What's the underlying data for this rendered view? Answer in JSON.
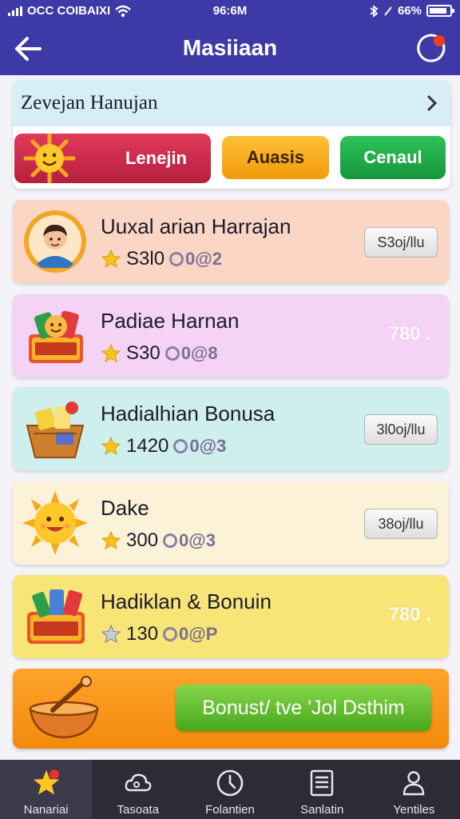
{
  "status": {
    "carrier": "OCC COIBAIXI",
    "time": "96:6M",
    "battery": "66%",
    "colors": {
      "header": "#3d3aa8"
    }
  },
  "header": {
    "title": "Masiiaan",
    "back_icon": "arrow-left-icon",
    "right_icon": "record-dot-icon"
  },
  "category": {
    "title": "Zevejan Hanujan",
    "chevron_icon": "chevron-right-icon",
    "tabs": [
      {
        "label": "Lenejin",
        "color": "#c8274a",
        "icon": "sun-icon"
      },
      {
        "label": "Auasis",
        "color": "#f6a916"
      },
      {
        "label": "Cenaul",
        "color": "#1ea646"
      }
    ]
  },
  "items": [
    {
      "title": "Uuxal arian Harrajan",
      "points": "S3l0",
      "coins": "0@2",
      "action": "S3oj/llu",
      "icon": "avatar-icon",
      "bg": "#fbd6c4"
    },
    {
      "title": "Padiae Harnan",
      "points": "S30",
      "coins": "0@8",
      "action": "780 .",
      "icon": "gift-box-icon",
      "bg": "#f5d3f4"
    },
    {
      "title": "Hadialhian Bonusa",
      "points": "1420",
      "coins": "0@3",
      "action": "3l0oj/llu",
      "icon": "basket-icon",
      "bg": "#cfeeee"
    },
    {
      "title": "Dake",
      "points": "300",
      "coins": "0@3",
      "action": "38oj/llu",
      "icon": "sun-icon",
      "bg": "#fbf2d8"
    },
    {
      "title": "Hadiklan & Bonuin",
      "points": "130",
      "coins": "0@P",
      "action": "780 .",
      "icon": "bonus-box-icon",
      "bg": "#f8e578"
    }
  ],
  "bonus": {
    "button_label": "Bonust/ tve 'Jol Dsthim",
    "icon": "bowl-icon"
  },
  "nav": [
    {
      "label": "Nanariai",
      "icon": "star-icon",
      "active": true
    },
    {
      "label": "Tasoata",
      "icon": "cloud-icon"
    },
    {
      "label": "Folantien",
      "icon": "clock-icon"
    },
    {
      "label": "Sanlatin",
      "icon": "list-icon"
    },
    {
      "label": "Yentiles",
      "icon": "person-icon"
    }
  ]
}
